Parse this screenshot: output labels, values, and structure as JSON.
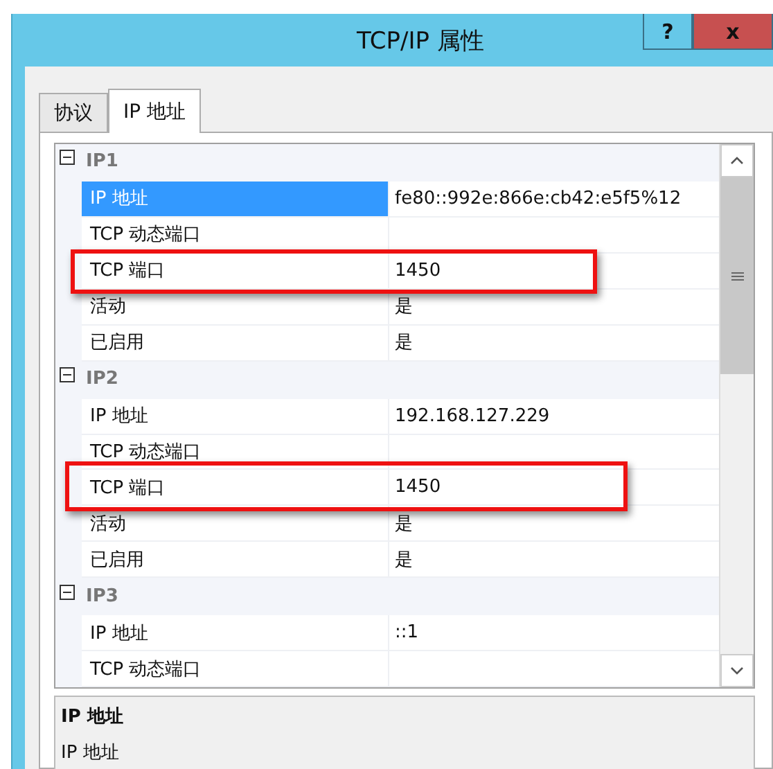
{
  "window": {
    "title": "TCP/IP 属性",
    "help_button": "?",
    "close_button": "x"
  },
  "tabs": [
    {
      "label": "协议",
      "selected": false
    },
    {
      "label": "IP 地址",
      "selected": true
    }
  ],
  "groups": [
    {
      "name": "IP1",
      "expanded": true,
      "rows": [
        {
          "label": "IP 地址",
          "value": "fe80::992e:866e:cb42:e5f5%12",
          "selected": true,
          "highlighted": false
        },
        {
          "label": "TCP 动态端口",
          "value": "",
          "selected": false,
          "highlighted": false
        },
        {
          "label": "TCP 端口",
          "value": "1450",
          "selected": false,
          "highlighted": true
        },
        {
          "label": "活动",
          "value": "是",
          "selected": false,
          "highlighted": false
        },
        {
          "label": "已启用",
          "value": "是",
          "selected": false,
          "highlighted": false
        }
      ]
    },
    {
      "name": "IP2",
      "expanded": true,
      "rows": [
        {
          "label": "IP 地址",
          "value": "192.168.127.229",
          "selected": false,
          "highlighted": false
        },
        {
          "label": "TCP 动态端口",
          "value": "",
          "selected": false,
          "highlighted": false
        },
        {
          "label": "TCP 端口",
          "value": "1450",
          "selected": false,
          "highlighted": true
        },
        {
          "label": "活动",
          "value": "是",
          "selected": false,
          "highlighted": false
        },
        {
          "label": "已启用",
          "value": "是",
          "selected": false,
          "highlighted": false
        }
      ]
    },
    {
      "name": "IP3",
      "expanded": true,
      "rows": [
        {
          "label": "IP 地址",
          "value": "::1",
          "selected": false,
          "highlighted": false
        },
        {
          "label": "TCP 动态端口",
          "value": "",
          "selected": false,
          "highlighted": false
        }
      ]
    }
  ],
  "description": {
    "title": "IP 地址",
    "text": "IP 地址"
  }
}
